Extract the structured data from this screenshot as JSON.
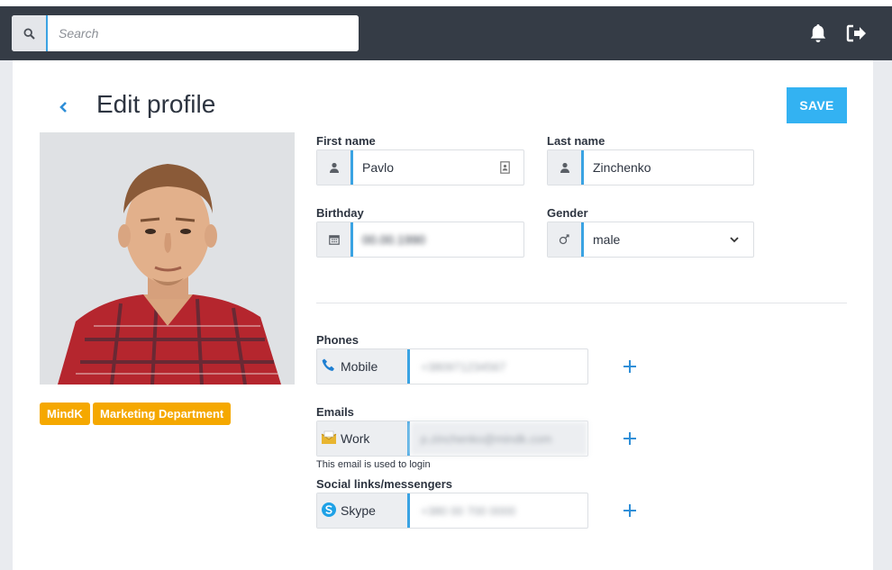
{
  "search": {
    "placeholder": "Search"
  },
  "header": {
    "title": "Edit profile",
    "save_label": "SAVE"
  },
  "tags": [
    "MindK",
    "Marketing Department"
  ],
  "form": {
    "first_name_label": "First name",
    "first_name_value": "Pavlo",
    "last_name_label": "Last name",
    "last_name_value": "Zinchenko",
    "birthday_label": "Birthday",
    "birthday_value": "00.00.1990",
    "gender_label": "Gender",
    "gender_value": "male",
    "phones_label": "Phones",
    "phone_type": "Mobile",
    "phone_value": "+380971234567",
    "emails_label": "Emails",
    "email_type": "Work",
    "email_value": "p.zinchenko@mindk.com",
    "email_hint": "This email is used to login",
    "social_label": "Social links/messengers",
    "social_type": "Skype",
    "social_value": "+380 00 700 0000"
  },
  "colors": {
    "accent": "#3aa3e3",
    "save": "#33b2f2",
    "tag": "#f5a800",
    "topbar": "#353c46"
  },
  "icons": [
    "search-icon",
    "bell-icon",
    "logout-icon",
    "back-chevron-icon",
    "user-icon",
    "contact-card-icon",
    "calendar-icon",
    "gender-icon",
    "phone-icon",
    "envelope-icon",
    "skype-icon",
    "plus-icon"
  ]
}
